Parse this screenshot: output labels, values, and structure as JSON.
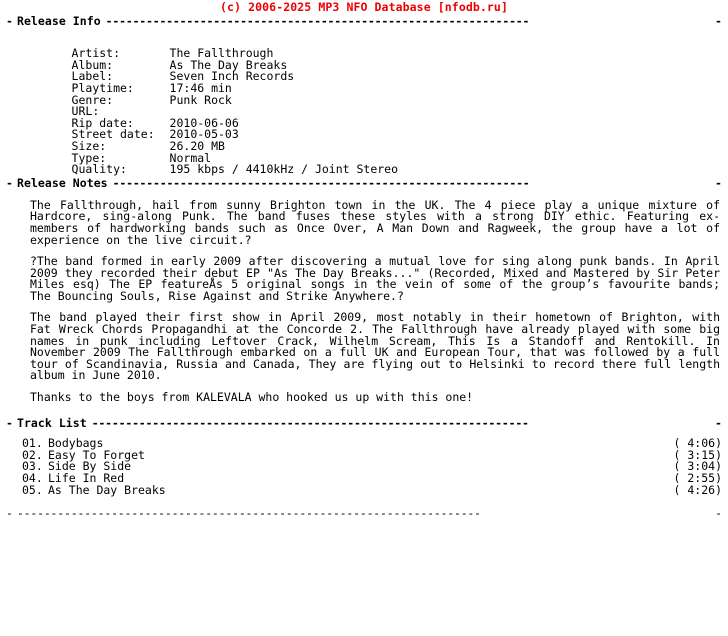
{
  "banner": {
    "text": "(c) 2006-2025 MP3 NFO Database [nfodb.ru]",
    "color": "#ee0000"
  },
  "sections": {
    "release_info": {
      "dash_left": "-",
      "title": "Release Info",
      "rule": "---------------------------------------------------------------",
      "dash_right": "-"
    },
    "release_notes": {
      "dash_left": "-",
      "title": "Release Notes",
      "rule": "--------------------------------------------------------------",
      "dash_right": "-"
    },
    "track_list": {
      "dash_left": "-",
      "title": "Track List",
      "rule": "-----------------------------------------------------------------",
      "dash_right": "-"
    }
  },
  "release_info": {
    "rows": [
      {
        "label": "Artist:",
        "value": "The Fallthrough"
      },
      {
        "label": "Album:",
        "value": "As The Day Breaks"
      },
      {
        "label": "Label:",
        "value": "Seven Inch Records"
      },
      {
        "label": "Playtime:",
        "value": "17:46 min"
      },
      {
        "label": "Genre:",
        "value": "Punk Rock"
      },
      {
        "label": "URL:",
        "value": ""
      },
      {
        "label": "Rip date:",
        "value": "2010-06-06"
      },
      {
        "label": "Street date:",
        "value": "2010-05-03"
      },
      {
        "label": "Size:",
        "value": "26.20 MB"
      },
      {
        "label": "Type:",
        "value": "Normal"
      },
      {
        "label": "Quality:",
        "value": "195 kbps / 4410kHz / Joint Stereo"
      }
    ]
  },
  "release_notes": {
    "paragraphs": [
      "The Fallthrough, hail from sunny Brighton town in the UK. The 4 piece play a unique mixture of Hardcore, sing-along Punk. The band fuses these styles with a strong DIY ethic. Featuring ex-members of hardworking bands such as Once Over, A Man Down and Ragweek, the group have a lot of experience on the live circuit.?",
      "?The band formed in early 2009 after discovering a mutual love for sing along punk bands. In April 2009 they recorded their debut EP \"As The Day Breaks...\" (Recorded, Mixed and Mastered by Sir Peter Miles esq) The EP featureÅs 5 original songs in the vein of some of the group’s favourite bands; The Bouncing Souls, Rise Against and Strike Anywhere.?",
      "The band played their first show in April 2009, most notably in their hometown of Brighton, with Fat Wreck Chords Propagandhi at the Concorde 2. The Fallthrough have already played with some big names in punk including Leftover Crack, Wilhelm Scream, This Is a Standoff and Rentokill. In November 2009 The Fallthrough embarked on a full UK and European Tour, that was followed by a full tour of Scandinavia, Russia and Canada, They are flying out to Helsinki to record there full length album in June 2010.",
      "Thanks to the boys from KALEVALA who hooked us up with this one!"
    ]
  },
  "track_list": {
    "tracks": [
      {
        "num": "01.",
        "title": "Bodybags",
        "time": "( 4:06)"
      },
      {
        "num": "02.",
        "title": "Easy To Forget",
        "time": "( 3:15)"
      },
      {
        "num": "03.",
        "title": "Side By Side",
        "time": "( 3:04)"
      },
      {
        "num": "04.",
        "title": "Life In Red",
        "time": "( 2:55)"
      },
      {
        "num": "05.",
        "title": "As The Day Breaks",
        "time": "( 4:26)"
      }
    ]
  },
  "footer": {
    "dash_left": "-",
    "rule": "---------------------------------------------------------------------",
    "dash_right": "-"
  }
}
